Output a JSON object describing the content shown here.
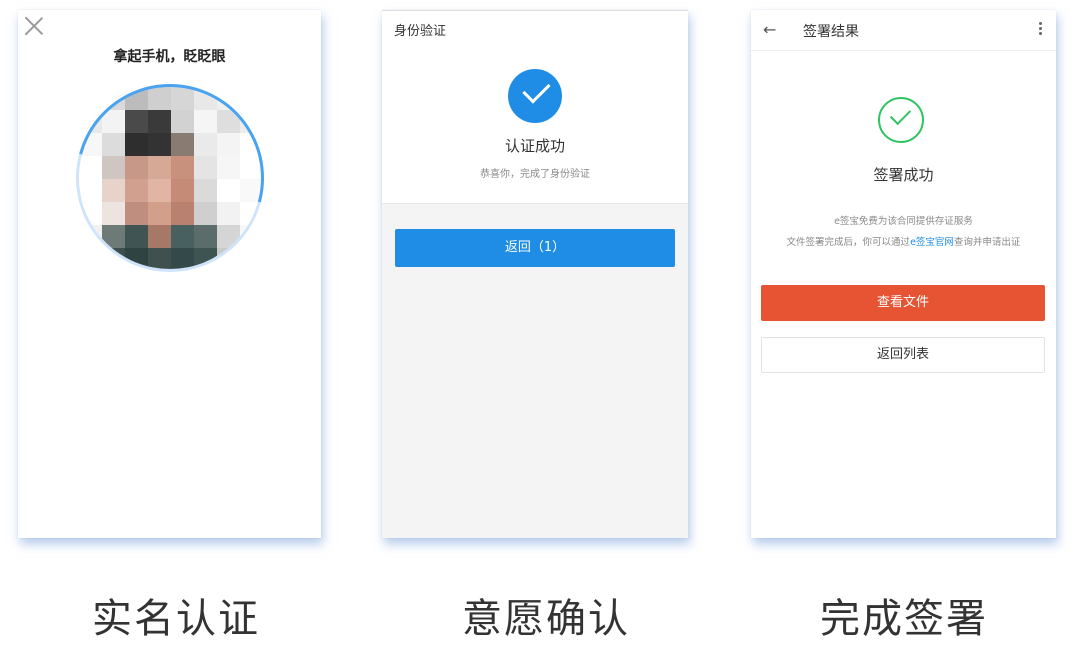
{
  "screens": [
    {
      "title": "拿起手机，眨眨眼",
      "caption": "实名认证"
    },
    {
      "header_title": "身份验证",
      "success_text": "认证成功",
      "sub_text": "恭喜你，完成了身份验证",
      "button_label": "返回（1）",
      "caption": "意愿确认"
    },
    {
      "header_title": "签署结果",
      "success_text": "签署成功",
      "note_line1": "e签宝免费为该合同提供存证服务",
      "note_line2_prefix": "文件签署完成后，你可以通过",
      "note_line2_link": "e签宝官网",
      "note_line2_suffix": "查询并申请出证",
      "view_button": "查看文件",
      "list_button": "返回列表",
      "caption": "完成签署"
    }
  ],
  "icons": {
    "close": "close-icon",
    "check_blue": "check-circle-icon",
    "check_green": "check-circle-outline-icon",
    "back": "back-arrow-icon",
    "more": "more-vertical-icon"
  },
  "colors": {
    "primary_blue": "#1f8de6",
    "success_green": "#2fc461",
    "danger_orange": "#e65434"
  }
}
